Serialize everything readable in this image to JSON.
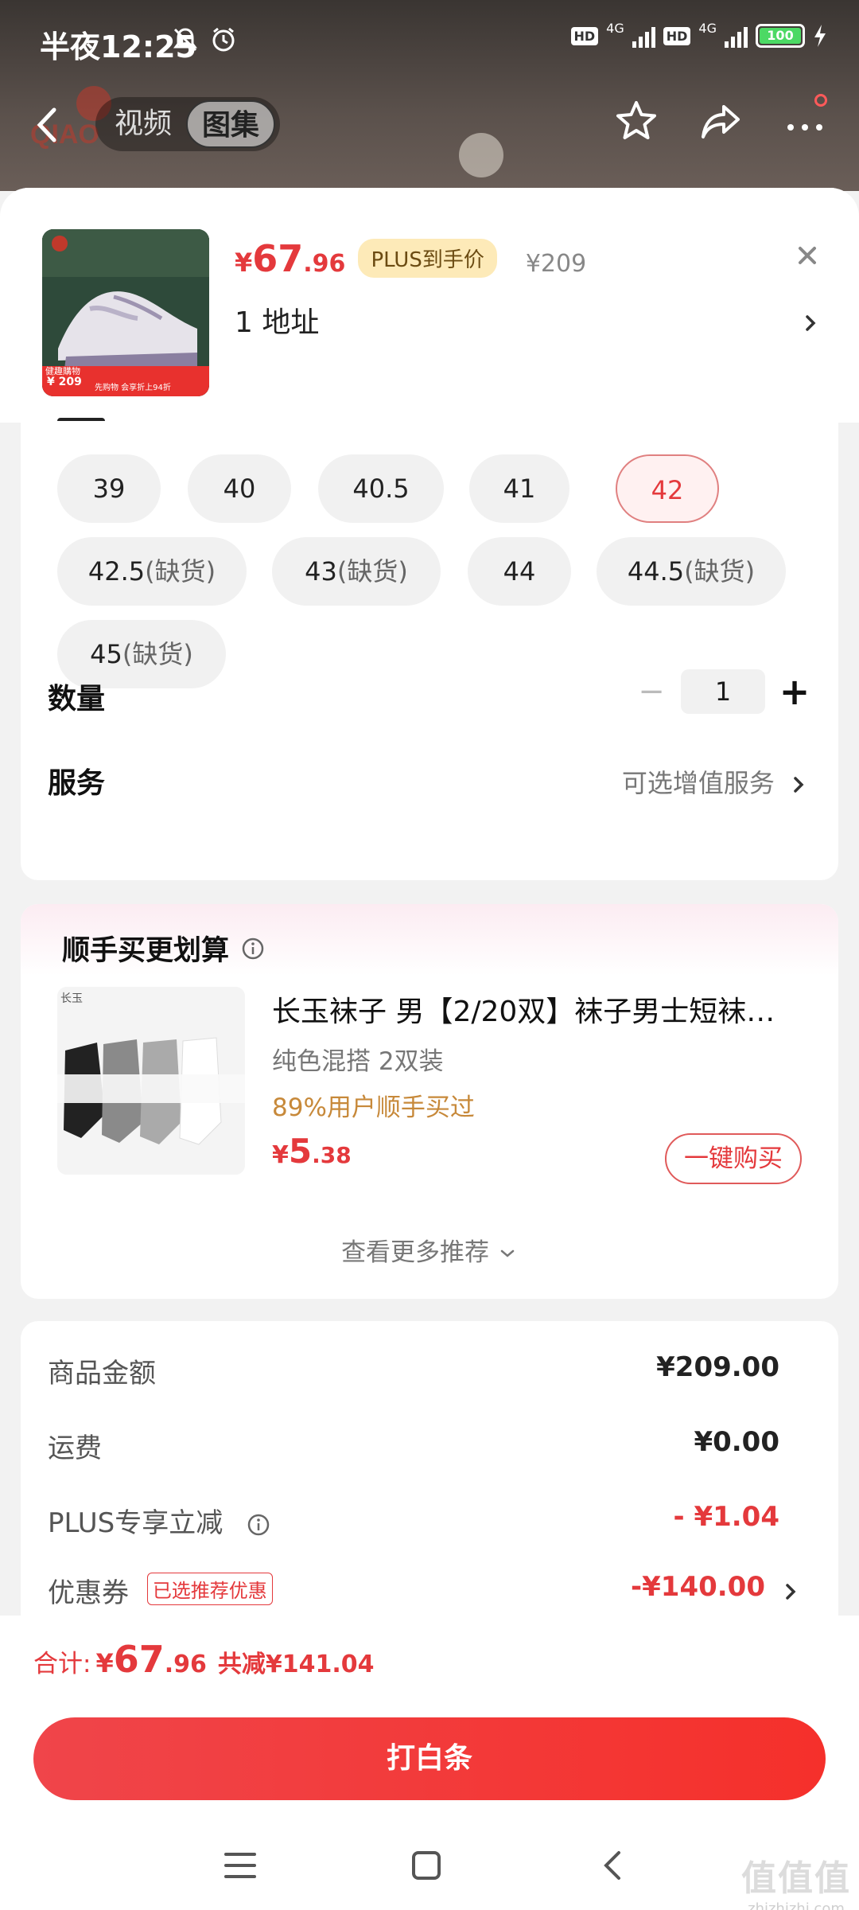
{
  "status_bar": {
    "time": "半夜12:25",
    "battery": "100",
    "network1": "4G",
    "network2": "4G",
    "hd1": "HD",
    "hd2": "HD"
  },
  "nav": {
    "tabs": [
      {
        "label": "视频",
        "active": false
      },
      {
        "label": "图集",
        "active": true
      }
    ]
  },
  "product": {
    "price_symbol": "¥",
    "price_int": "67",
    "price_dec": ".96",
    "plus_badge": "PLUS到手价",
    "original_price": "¥209",
    "address": "1  地址",
    "thumb_text_1": "健趣購物",
    "thumb_price": "¥ 209",
    "thumb_text_2": "先购物 会享折上94折"
  },
  "sizes": [
    {
      "label": "39",
      "note": "",
      "selected": false
    },
    {
      "label": "40",
      "note": "",
      "selected": false
    },
    {
      "label": "40.5",
      "note": "",
      "selected": false
    },
    {
      "label": "41",
      "note": "",
      "selected": false
    },
    {
      "label": "42",
      "note": "",
      "selected": true
    },
    {
      "label": "42.5",
      "note": "(缺货)",
      "selected": false
    },
    {
      "label": "43",
      "note": "(缺货)",
      "selected": false
    },
    {
      "label": "44",
      "note": "",
      "selected": false
    },
    {
      "label": "44.5",
      "note": "(缺货)",
      "selected": false
    },
    {
      "label": "45",
      "note": "(缺货)",
      "selected": false
    }
  ],
  "quantity": {
    "label": "数量",
    "minus": "−",
    "value": "1",
    "plus": "+"
  },
  "service": {
    "label": "服务",
    "value": "可选增值服务"
  },
  "bundle": {
    "title": "顺手买更划算",
    "name": "长玉袜子 男【2/20双】袜子男士短袜…",
    "spec": "纯色混搭    2双装",
    "bought": "89%用户顺手买过",
    "price_symbol": "¥",
    "price_int": "5",
    "price_dec": ".38",
    "buy_button": "一键购买",
    "more": "查看更多推荐",
    "img_brand": "长玉"
  },
  "summary": {
    "rows": [
      {
        "label": "商品金额",
        "value": "¥209.00",
        "red": false
      },
      {
        "label": "运费",
        "value": "¥0.00",
        "red": false
      },
      {
        "label": "PLUS专享立减",
        "value": "- ¥1.04",
        "red": true
      },
      {
        "label": "优惠券",
        "value": "-¥140.00",
        "red": true
      }
    ],
    "coupon_tag": "已选推荐优惠"
  },
  "footer": {
    "total_label": "合计:",
    "total_symbol": "¥",
    "total_int": "67",
    "total_dec": ".96",
    "total_save": "共减¥141.04",
    "pay_button": "打白条"
  },
  "watermark": {
    "main": "值值值",
    "sub": "zhizhizhi.com"
  },
  "colors": {
    "accent": "#e4393c",
    "plus_badge_bg": "#fdeab8",
    "gold_text": "#c7893a"
  }
}
